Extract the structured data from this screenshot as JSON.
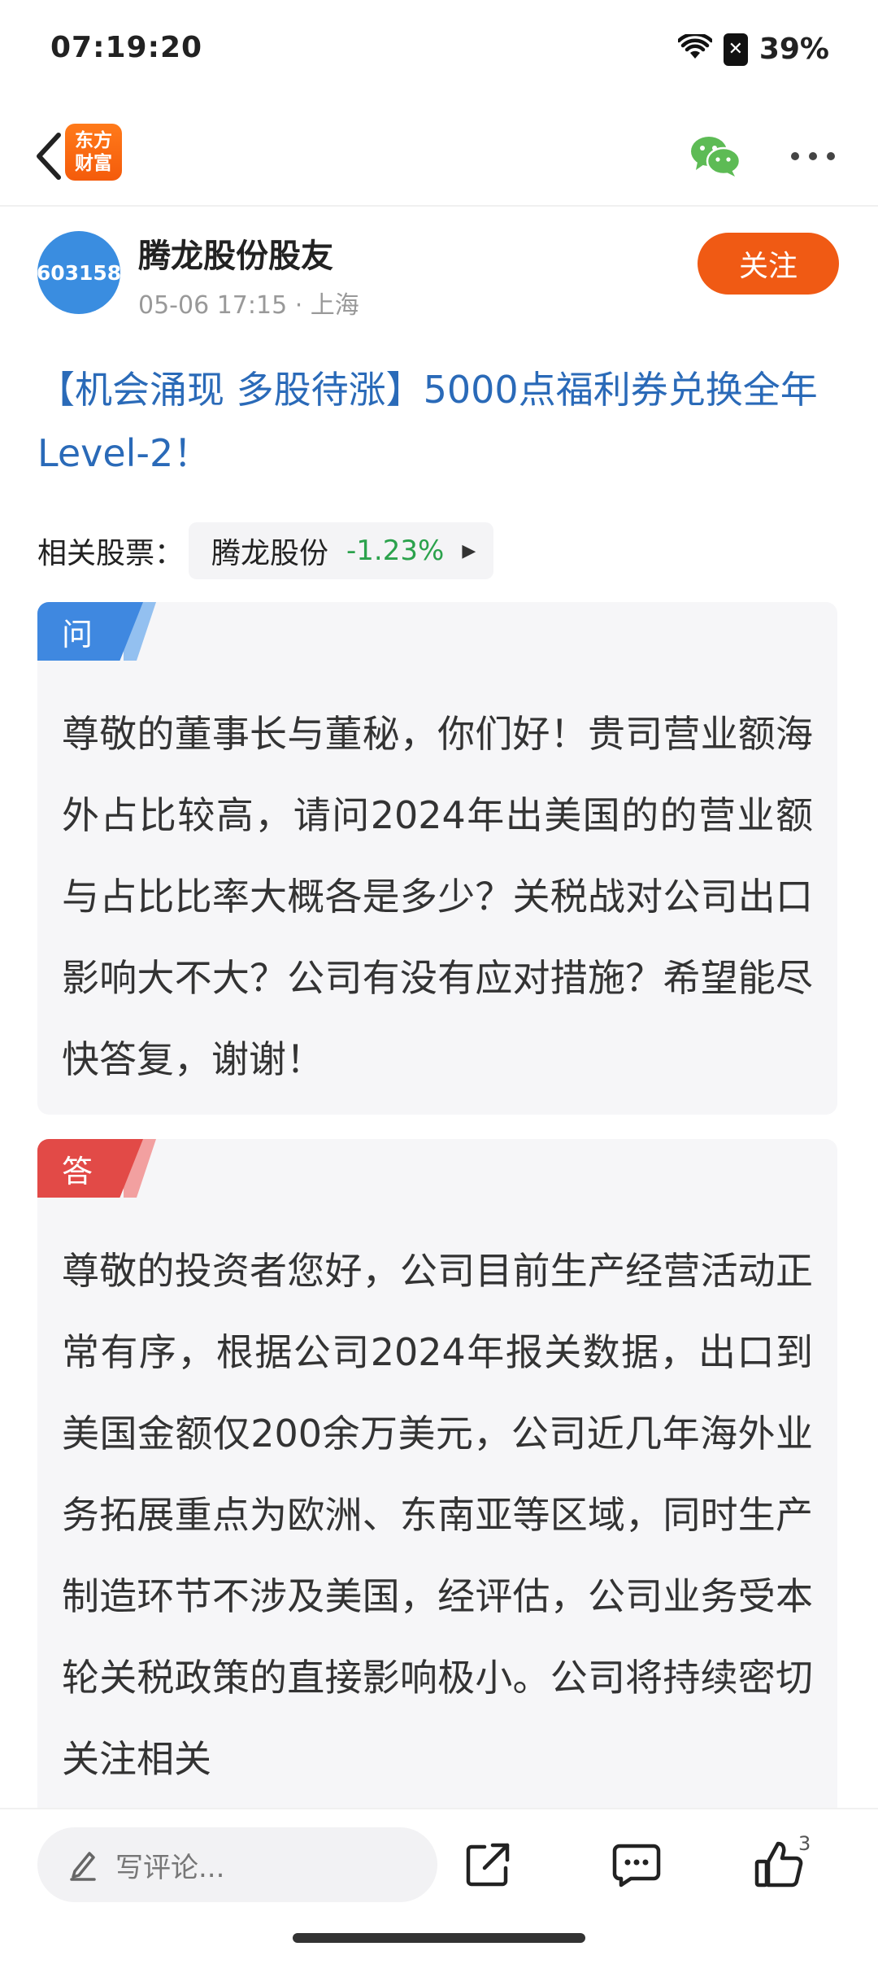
{
  "status_bar": {
    "time": "07:19:20",
    "battery_text": "39%"
  },
  "nav": {
    "logo_line1": "东方",
    "logo_line2": "财富",
    "brand_color": "#f45b0b"
  },
  "author": {
    "avatar_text": "603158",
    "name": "腾龙股份股友",
    "meta": "05-06 17:15 · 上海",
    "follow_label": "关注"
  },
  "post": {
    "title": "【机会涌现 多股待涨】5000点福利券兑换全年Level-2！",
    "related_label": "相关股票：",
    "stock": {
      "name": "腾龙股份",
      "change": "-1.23%",
      "change_color": "#2ba24c"
    }
  },
  "question": {
    "tag": "问",
    "text": "尊敬的董事长与董秘，你们好！贵司营业额海外占比较高，请问2024年出美国的的营业额与占比比率大概各是多少？关税战对公司出口影响大不大？公司有没有应对措施？希望能尽快答复，谢谢！"
  },
  "answer": {
    "tag": "答",
    "text": "尊敬的投资者您好，公司目前生产经营活动正常有序，根据公司2024年报关数据，出口到美国金额仅200余万美元，公司近几年海外业务拓展重点为欧洲、东南亚等区域，同时生产制造环节不涉及美国，经评估，公司业务受本轮关税政策的直接影响极小。公司将持续密切关注相关"
  },
  "bottom_bar": {
    "comment_placeholder": "写评论...",
    "like_count": "3"
  },
  "icons": [
    "back-icon",
    "wechat-icon",
    "more-icon",
    "pencil-icon",
    "share-icon",
    "comment-icon",
    "like-icon"
  ]
}
